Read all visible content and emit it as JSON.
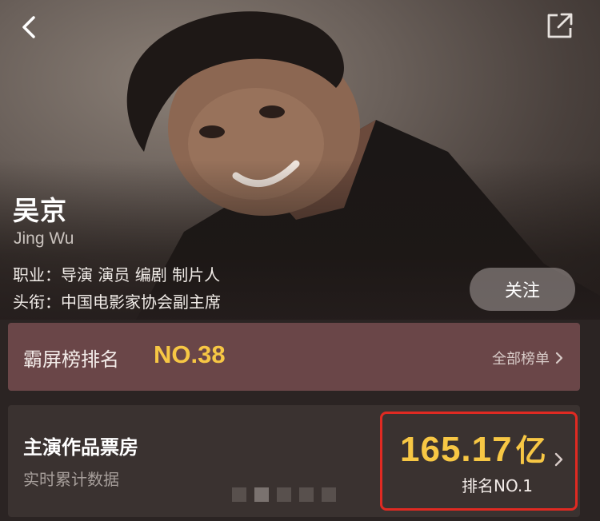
{
  "hero": {
    "name": "吴京",
    "name_en": "Jing Wu",
    "occupation": "职业：导演 演员 编剧 制片人",
    "title": "头衔：中国电影家协会副主席",
    "follow_label": "关注"
  },
  "ranking": {
    "title": "霸屏榜排名",
    "value": "NO.38",
    "all_label": "全部榜单"
  },
  "box_office": {
    "title": "主演作品票房",
    "subtitle": "实时累计数据",
    "value": "165.17",
    "unit": "亿",
    "rank": "排名NO.1"
  },
  "carousel": {
    "page_count": 5,
    "active_index": 1
  },
  "colors": {
    "accent_gold": "#f7c744",
    "rank_bar_bg": "#6a4648",
    "card_bg": "#3a3230",
    "highlight_border": "#e02a22"
  },
  "icons": {
    "back": "chevron-left-icon",
    "share": "share-icon",
    "chevron": "chevron-right-icon"
  }
}
